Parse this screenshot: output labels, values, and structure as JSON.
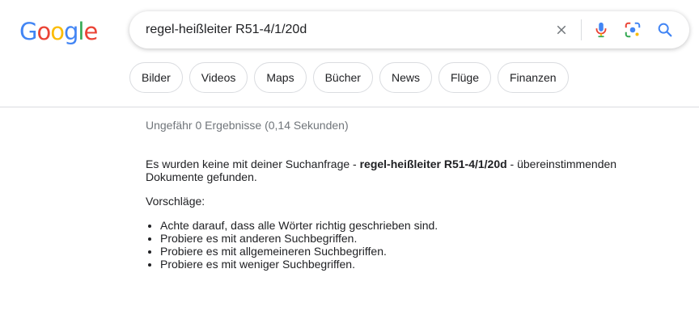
{
  "logo": {
    "letters": [
      "G",
      "o",
      "o",
      "g",
      "l",
      "e"
    ],
    "colors": [
      "#4285F4",
      "#EA4335",
      "#FBBC05",
      "#4285F4",
      "#34A853",
      "#EA4335"
    ]
  },
  "search": {
    "query": "regel-heißleiter R51-4/1/20d",
    "clear_icon": "close-icon",
    "voice_icon": "microphone-icon",
    "lens_icon": "camera-lens-icon",
    "search_icon": "search-icon"
  },
  "chips": [
    {
      "label": "Bilder"
    },
    {
      "label": "Videos"
    },
    {
      "label": "Maps"
    },
    {
      "label": "Bücher"
    },
    {
      "label": "News"
    },
    {
      "label": "Flüge"
    },
    {
      "label": "Finanzen"
    }
  ],
  "stats": "Ungefähr 0 Ergebnisse (0,14 Sekunden)",
  "no_results": {
    "prefix": "Es wurden keine mit deiner Suchanfrage - ",
    "query": "regel-heißleiter R51-4/1/20d",
    "suffix": " - übereinstimmenden Dokumente gefunden."
  },
  "suggestions": {
    "title": "Vorschläge:",
    "items": [
      "Achte darauf, dass alle Wörter richtig geschrieben sind.",
      "Probiere es mit anderen Suchbegriffen.",
      "Probiere es mit allgemeineren Suchbegriffen.",
      "Probiere es mit weniger Suchbegriffen."
    ]
  },
  "colors": {
    "search_blue": "#4285F4",
    "divider": "#dadce0",
    "muted_text": "#70757a"
  }
}
